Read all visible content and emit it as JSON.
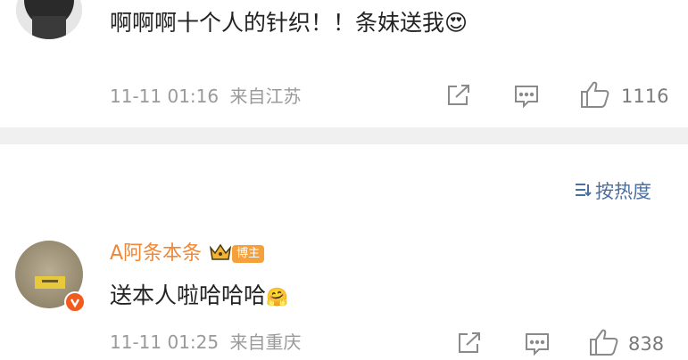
{
  "comments": [
    {
      "text": "啊啊啊十个人的针织！！条妹送我",
      "emoji": "😍",
      "time": "11-11 01:16",
      "location": "来自江苏",
      "likes": "1116"
    },
    {
      "username": "A阿条本条",
      "badge": "博主",
      "text": "送本人啦哈哈哈",
      "emoji": "🤗",
      "time": "11-11 01:25",
      "location": "来自重庆",
      "likes": "838"
    }
  ],
  "sort": {
    "label": "按热度"
  },
  "colors": {
    "username": "#ef8737",
    "sort": "#4b6f9e",
    "verified": "#f25a1e",
    "divider": "#f0f0f0"
  },
  "icons": [
    "share-icon",
    "comment-icon",
    "like-icon",
    "sort-icon",
    "crown-icon",
    "verified-icon"
  ]
}
